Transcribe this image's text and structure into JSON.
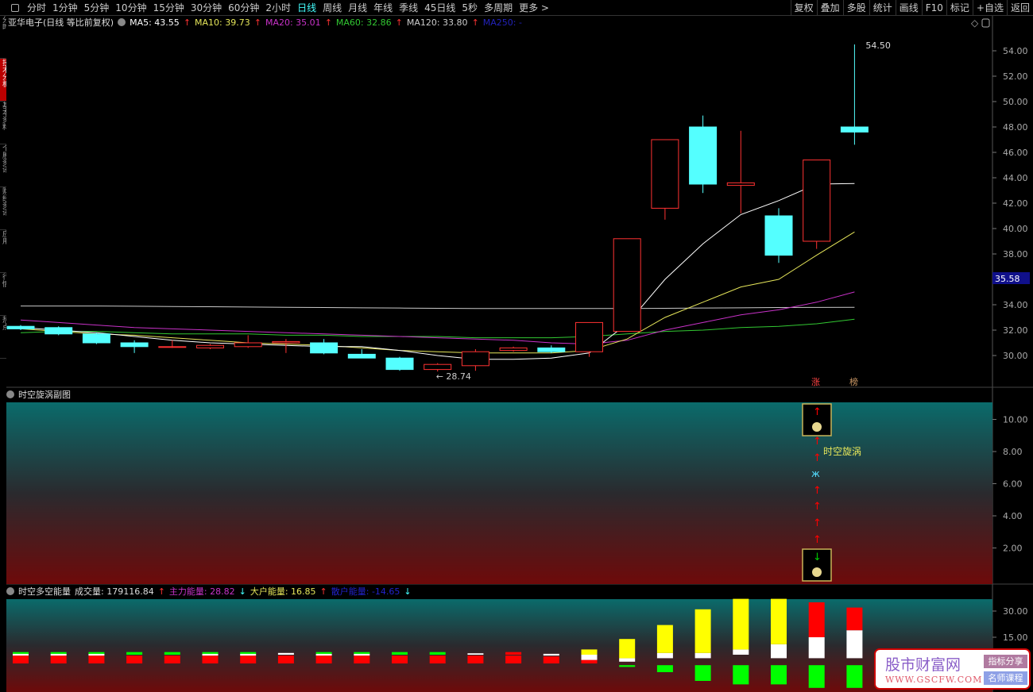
{
  "toolbar": {
    "periods": [
      "分时",
      "1分钟",
      "5分钟",
      "10分钟",
      "15分钟",
      "30分钟",
      "60分钟",
      "2小时",
      "日线",
      "周线",
      "月线",
      "年线",
      "季线",
      "45日线",
      "5秒",
      "多周期",
      "更多 >"
    ],
    "active": "日线",
    "right": [
      "复权",
      "叠加",
      "多股",
      "统计",
      "画线",
      "F10",
      "标记",
      "+自选",
      "返回"
    ]
  },
  "left_tabs": [
    "分时",
    "技术分析",
    "基本资料",
    "个股资讯",
    "财经资讯",
    "应用",
    "行情",
    "热点"
  ],
  "info": {
    "title": "亚华电子(日线 等比前复权)",
    "ma5": "MA5: 43.55",
    "ma10": "MA10: 39.73",
    "ma20": "MA20: 35.01",
    "ma60": "MA60: 32.86",
    "ma120": "MA120: 33.80",
    "ma250": "MA250: -"
  },
  "colors": {
    "up": "#ff3232",
    "down": "#54ffff",
    "ma5": "#ffffff",
    "ma10": "#e6e65a",
    "ma20": "#c832c8",
    "ma60": "#32c832",
    "ma120": "#c8c8c8"
  },
  "chart_data": [
    {
      "type": "candlestick",
      "title": "亚华电子 日线",
      "ylim": [
        28,
        56
      ],
      "yticks": [
        "30.00",
        "32.00",
        "34.00",
        "36.00",
        "38.00",
        "40.00",
        "42.00",
        "44.00",
        "46.00",
        "48.00",
        "50.00",
        "52.00",
        "54.00"
      ],
      "ohlc": [
        [
          32.3,
          32.4,
          32.0,
          32.1
        ],
        [
          32.2,
          32.3,
          31.6,
          31.7
        ],
        [
          31.7,
          31.8,
          30.9,
          31.0
        ],
        [
          31.0,
          31.2,
          30.2,
          30.7
        ],
        [
          30.7,
          31.2,
          30.6,
          30.7
        ],
        [
          30.6,
          30.9,
          30.5,
          30.8
        ],
        [
          30.7,
          31.6,
          30.6,
          31.0
        ],
        [
          31.0,
          31.3,
          30.2,
          31.1
        ],
        [
          31.0,
          31.3,
          30.1,
          30.2
        ],
        [
          30.1,
          30.5,
          29.8,
          29.8
        ],
        [
          29.8,
          29.9,
          28.8,
          28.9
        ],
        [
          28.9,
          29.4,
          28.74,
          29.3
        ],
        [
          29.2,
          30.5,
          28.8,
          30.3
        ],
        [
          30.4,
          30.7,
          30.3,
          30.6
        ],
        [
          30.6,
          30.8,
          30.2,
          30.3
        ],
        [
          30.3,
          32.6,
          29.9,
          32.6
        ],
        [
          31.9,
          39.2,
          31.9,
          39.2
        ],
        [
          41.6,
          47.0,
          40.7,
          47.0
        ],
        [
          48.0,
          48.9,
          42.8,
          43.5
        ],
        [
          43.4,
          47.7,
          41.2,
          43.6
        ],
        [
          41.0,
          41.6,
          37.3,
          37.9
        ],
        [
          39.0,
          45.4,
          38.4,
          45.4
        ],
        [
          48.0,
          54.5,
          46.6,
          47.6
        ]
      ],
      "ma": {
        "ma5": [
          32.2,
          32.0,
          31.8,
          31.5,
          31.2,
          31.0,
          30.9,
          30.8,
          30.7,
          30.7,
          30.4,
          30.0,
          29.7,
          29.7,
          29.8,
          30.2,
          32.5,
          36.0,
          38.8,
          41.1,
          42.2,
          43.5,
          43.55
        ],
        "ma10": [
          32.1,
          31.9,
          31.7,
          31.6,
          31.4,
          31.2,
          31.0,
          30.9,
          30.8,
          30.6,
          30.4,
          30.3,
          30.2,
          30.2,
          30.2,
          30.4,
          31.3,
          33.0,
          34.2,
          35.4,
          36.0,
          37.9,
          39.73
        ],
        "ma20": [
          32.8,
          32.6,
          32.4,
          32.2,
          32.1,
          32.0,
          31.9,
          31.8,
          31.7,
          31.6,
          31.5,
          31.4,
          31.3,
          31.2,
          31.0,
          30.9,
          31.2,
          32.0,
          32.6,
          33.2,
          33.6,
          34.2,
          35.01
        ],
        "ma60": [
          31.8,
          31.9,
          31.9,
          31.8,
          31.7,
          31.7,
          31.7,
          31.6,
          31.6,
          31.5,
          31.5,
          31.5,
          31.4,
          31.4,
          31.4,
          31.5,
          31.7,
          31.9,
          32.0,
          32.2,
          32.3,
          32.5,
          32.86
        ],
        "ma120": [
          33.9,
          33.9,
          33.9,
          33.88,
          33.86,
          33.84,
          33.82,
          33.8,
          33.78,
          33.76,
          33.74,
          33.72,
          33.7,
          33.7,
          33.7,
          33.7,
          33.7,
          33.72,
          33.74,
          33.76,
          33.78,
          33.79,
          33.8
        ]
      },
      "annotations": {
        "high": "54.50",
        "low": "← 28.74",
        "crosshair_price": "35.58",
        "mark1": "涨",
        "mark2": "榜"
      }
    },
    {
      "type": "indicator",
      "title": "时空旋涡副图",
      "ylim": [
        0,
        11
      ],
      "yticks": [
        "2.00",
        "4.00",
        "6.00",
        "8.00",
        "10.00"
      ],
      "signal_label": "时空旋涡"
    },
    {
      "type": "stacked-bar",
      "title": "时空多空能量",
      "ylim": [
        -16,
        38
      ],
      "yticks": [
        "15.00",
        "30.00"
      ],
      "legend": {
        "volume": "成交量: 179116.84",
        "main": "主力能量: 28.82",
        "big": "大户能量: 16.85",
        "retail": "散户能量: -14.65"
      },
      "bars": [
        [
          [
            0,
            4.5,
            "#ff0000"
          ],
          [
            4.5,
            5.5,
            "#ffffff"
          ],
          [
            5.5,
            6.5,
            "#00ff00"
          ]
        ],
        [
          [
            0,
            4.5,
            "#ff0000"
          ],
          [
            4.5,
            5.5,
            "#ffffff"
          ],
          [
            5.5,
            6.5,
            "#00ff00"
          ]
        ],
        [
          [
            0,
            4.5,
            "#ff0000"
          ],
          [
            4.5,
            5.5,
            "#ffffff"
          ],
          [
            5.5,
            6.5,
            "#00ff00"
          ]
        ],
        [
          [
            0,
            4.5,
            "#ff0000"
          ],
          [
            5,
            6.5,
            "#00ff00"
          ]
        ],
        [
          [
            0,
            4.5,
            "#ff0000"
          ],
          [
            5,
            6.5,
            "#00ff00"
          ]
        ],
        [
          [
            0,
            4.5,
            "#ff0000"
          ],
          [
            4.5,
            5.5,
            "#ffffff"
          ],
          [
            5.5,
            6.5,
            "#00ff00"
          ]
        ],
        [
          [
            0,
            4.5,
            "#ff0000"
          ],
          [
            4.5,
            5.5,
            "#ffffff"
          ],
          [
            5.5,
            6.5,
            "#00ff00"
          ]
        ],
        [
          [
            0,
            4.5,
            "#ff0000"
          ],
          [
            5,
            6,
            "#ffffff"
          ]
        ],
        [
          [
            0,
            4.5,
            "#ff0000"
          ],
          [
            4.5,
            5.5,
            "#ffffff"
          ],
          [
            5.5,
            6.5,
            "#00ff00"
          ]
        ],
        [
          [
            0,
            4.5,
            "#ff0000"
          ],
          [
            4.5,
            5.5,
            "#ffffff"
          ],
          [
            5.5,
            6.5,
            "#00ff00"
          ]
        ],
        [
          [
            0,
            4.5,
            "#ff0000"
          ],
          [
            5,
            6.5,
            "#00ff00"
          ]
        ],
        [
          [
            0,
            4.5,
            "#ff0000"
          ],
          [
            5,
            6.5,
            "#00ff00"
          ]
        ],
        [
          [
            0,
            4.5,
            "#ff0000"
          ],
          [
            5,
            5.8,
            "#ffffff"
          ]
        ],
        [
          [
            0,
            4.5,
            "#ff0000"
          ],
          [
            5,
            6.5,
            "#ff0000"
          ]
        ],
        [
          [
            0,
            4,
            "#ff0000"
          ],
          [
            4.5,
            5.5,
            "#ffffff"
          ]
        ],
        [
          [
            0,
            2,
            "#ff0000"
          ],
          [
            2,
            5,
            "#ffffff"
          ],
          [
            5,
            8,
            "#ffff00"
          ]
        ],
        [
          [
            -2,
            -1,
            "#00ff00"
          ],
          [
            1,
            3,
            "#ffffff"
          ],
          [
            3,
            14,
            "#ffff00"
          ]
        ],
        [
          [
            -5,
            -1,
            "#00ff00"
          ],
          [
            3,
            6,
            "#ffffff"
          ],
          [
            6,
            22,
            "#ffff00"
          ]
        ],
        [
          [
            -10,
            -1,
            "#00ff00"
          ],
          [
            3,
            6,
            "#ffffff"
          ],
          [
            6,
            31,
            "#ffff00"
          ]
        ],
        [
          [
            -12,
            -1,
            "#00ff00"
          ],
          [
            5,
            8,
            "#ffffff"
          ],
          [
            8,
            37,
            "#ffff00"
          ]
        ],
        [
          [
            -12,
            -1,
            "#00ff00"
          ],
          [
            3,
            11,
            "#ffffff"
          ],
          [
            11,
            37,
            "#ffff00"
          ]
        ],
        [
          [
            -14,
            -1,
            "#00ff00"
          ],
          [
            3,
            15,
            "#ffffff"
          ],
          [
            15,
            35,
            "#ff0000"
          ]
        ],
        [
          [
            -14,
            -1,
            "#00ff00"
          ],
          [
            3,
            19,
            "#ffffff"
          ],
          [
            19,
            32,
            "#ff0000"
          ]
        ]
      ]
    }
  ],
  "watermark": {
    "site": "股市财富网",
    "url": "WWW.GSCFW.COM",
    "tag1": "指标分享",
    "tag2": "名师课程"
  }
}
